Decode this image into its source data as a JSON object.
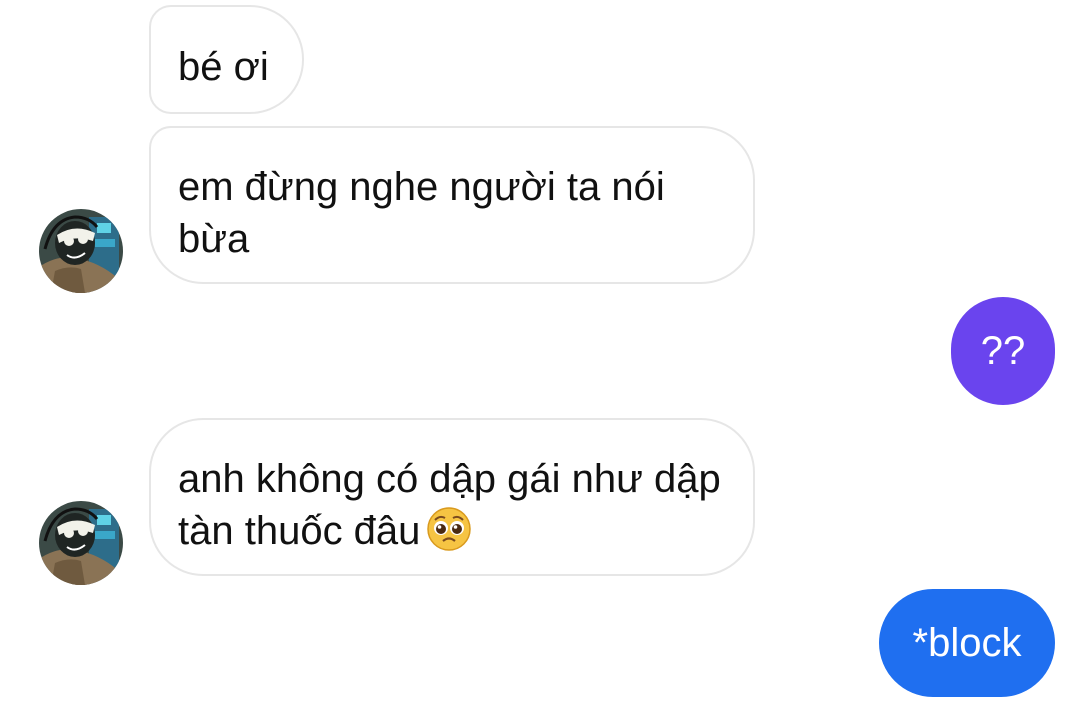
{
  "conversation": {
    "messages": [
      {
        "sender": "other",
        "text": "bé ơi"
      },
      {
        "sender": "other",
        "text": "em đừng nghe người ta nói bừa"
      },
      {
        "sender": "me",
        "text": "??",
        "color": "#6a44ee"
      },
      {
        "sender": "other",
        "text": "anh không có dập gái như dập tàn thuốc đâu",
        "emoji": "pleading-face-emoji"
      },
      {
        "sender": "me",
        "text": "*block",
        "color": "#1f6ff0"
      }
    ],
    "avatar_icon": "contact-avatar"
  }
}
